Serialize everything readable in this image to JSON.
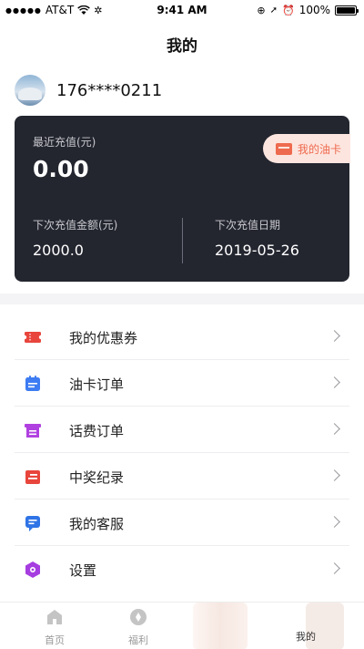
{
  "status_bar": {
    "carrier": "AT&T",
    "time": "9:41 AM",
    "battery": "100%"
  },
  "nav": {
    "title": "我的"
  },
  "profile": {
    "phone": "176****0211"
  },
  "card": {
    "recent_label": "最近充值(元)",
    "recent_amount": "0.00",
    "oil_card_button": "我的油卡",
    "next_amount_label": "下次充值金额(元)",
    "next_amount": "2000.0",
    "next_date_label": "下次充值日期",
    "next_date": "2019-05-26"
  },
  "menu": [
    {
      "label": "我的优惠券",
      "icon": "coupon-icon",
      "color": "#e8453c"
    },
    {
      "label": "油卡订单",
      "icon": "oil-card-order-icon",
      "color": "#3d7cf2"
    },
    {
      "label": "话费订单",
      "icon": "phone-bill-order-icon",
      "color": "#b040e0"
    },
    {
      "label": "中奖纪录",
      "icon": "prize-record-icon",
      "color": "#e8453c"
    },
    {
      "label": "我的客服",
      "icon": "customer-service-icon",
      "color": "#2f74e6"
    },
    {
      "label": "设置",
      "icon": "settings-icon",
      "color": "#a63de0"
    }
  ],
  "tabbar": {
    "tabs": [
      {
        "label": "首页",
        "icon": "home-icon"
      },
      {
        "label": "福利",
        "icon": "welfare-icon"
      },
      {
        "label": "我的",
        "icon": "profile-icon",
        "active": true
      }
    ]
  },
  "colors": {
    "card_bg": "#23252f",
    "accent": "#ee6a4e",
    "pill_bg": "#fde5df"
  }
}
